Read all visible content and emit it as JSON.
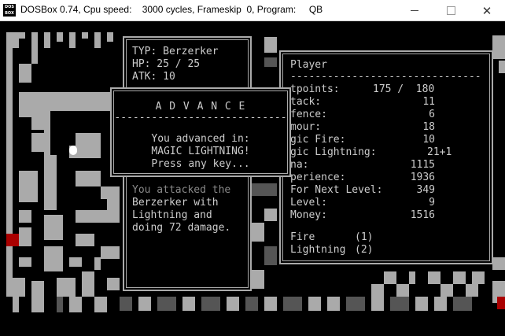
{
  "window": {
    "title": "DOSBox 0.74, Cpu speed:    3000 cycles, Frameskip  0, Program:     QB",
    "icon_name": "dosbox-icon",
    "icon_text_top": "DOS",
    "icon_text_bottom": "BOX",
    "minimize_icon": "minimize-icon",
    "maximize_icon": "maximize-icon",
    "close_icon": "close-icon"
  },
  "enemy_panel": {
    "type_line": "TYP: Berzerker",
    "hp_line": "HP: 25 / 25",
    "atk_line": "ATK: 10"
  },
  "dialog": {
    "title": "A D V A N C E",
    "divider": "----------------------------",
    "line1": "You advanced in:",
    "line2": "MAGIC LIGHTNING!",
    "line3": "Press any key..."
  },
  "combat_log": {
    "line1": "You attacked the",
    "line2": "Berzerker with",
    "line3": "Lightning and",
    "line4": "doing 72 damage."
  },
  "player_panel": {
    "title": "Player",
    "divider": "-------------------------------",
    "stats": [
      {
        "label": "tpoints:",
        "value": "175 /  180"
      },
      {
        "label": "tack:",
        "value": "11"
      },
      {
        "label": "fence:",
        "value": "6"
      },
      {
        "label": "mour:",
        "value": "18"
      },
      {
        "label": "gic Fire:",
        "value": "10"
      },
      {
        "label": "gic Lightning:",
        "value": "21+1"
      },
      {
        "label": "na:",
        "value": "1115"
      },
      {
        "label": "perience:",
        "value": "1936"
      },
      {
        "label": "For Next Level:",
        "value": "349"
      },
      {
        "label": "Level:",
        "value": "9"
      },
      {
        "label": "Money:",
        "value": "1516"
      }
    ],
    "spells": [
      {
        "name": "Fire",
        "key": "(1)"
      },
      {
        "name": "Lightning",
        "key": "(2)"
      }
    ]
  },
  "colors": {
    "wall": "#aaaaaa",
    "wall_dark": "#555555",
    "lava": "#aa0000",
    "text": "#cccccc"
  }
}
